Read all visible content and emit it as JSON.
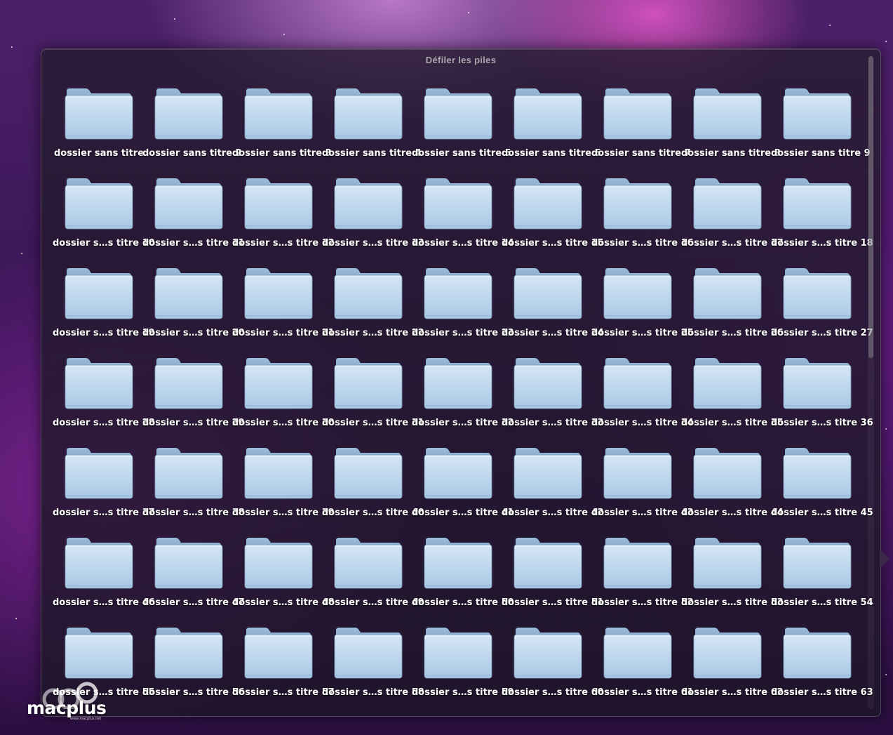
{
  "window": {
    "title": "Défiler les piles"
  },
  "items": [
    "dossier sans titre",
    "dossier sans titre 2",
    "dossier sans titre 3",
    "dossier sans titre 4",
    "dossier sans titre 5",
    "dossier sans titre 6",
    "dossier sans titre 7",
    "dossier sans titre 8",
    "dossier sans titre 9",
    "dossier s…s titre 10",
    "dossier s…s titre 11",
    "dossier s…s titre 12",
    "dossier s…s titre 13",
    "dossier s…s titre 14",
    "dossier s…s titre 15",
    "dossier s…s titre 16",
    "dossier s…s titre 17",
    "dossier s…s titre 18",
    "dossier s…s titre 19",
    "dossier s…s titre 20",
    "dossier s…s titre 21",
    "dossier s…s titre 22",
    "dossier s…s titre 23",
    "dossier s…s titre 24",
    "dossier s…s titre 25",
    "dossier s…s titre 26",
    "dossier s…s titre 27",
    "dossier s…s titre 28",
    "dossier s…s titre 29",
    "dossier s…s titre 30",
    "dossier s…s titre 31",
    "dossier s…s titre 32",
    "dossier s…s titre 33",
    "dossier s…s titre 34",
    "dossier s…s titre 35",
    "dossier s…s titre 36",
    "dossier s…s titre 37",
    "dossier s…s titre 38",
    "dossier s…s titre 39",
    "dossier s…s titre 40",
    "dossier s…s titre 41",
    "dossier s…s titre 42",
    "dossier s…s titre 43",
    "dossier s…s titre 44",
    "dossier s…s titre 45",
    "dossier s…s titre 46",
    "dossier s…s titre 47",
    "dossier s…s titre 48",
    "dossier s…s titre 49",
    "dossier s…s titre 50",
    "dossier s…s titre 51",
    "dossier s…s titre 52",
    "dossier s…s titre 53",
    "dossier s…s titre 54",
    "dossier s…s titre 55",
    "dossier s…s titre 56",
    "dossier s…s titre 57",
    "dossier s…s titre 58",
    "dossier s…s titre 59",
    "dossier s…s titre 60",
    "dossier s…s titre 61",
    "dossier s…s titre 62",
    "dossier s…s titre 63"
  ],
  "item_icon": "folder-icon",
  "colors": {
    "folder_light": "#c2d9ee",
    "folder_dark": "#8fb3d4",
    "label": "#ffffff"
  },
  "scroll": {
    "position": 0
  },
  "watermark": {
    "text": "macplus",
    "url": "www.macplus.net"
  }
}
